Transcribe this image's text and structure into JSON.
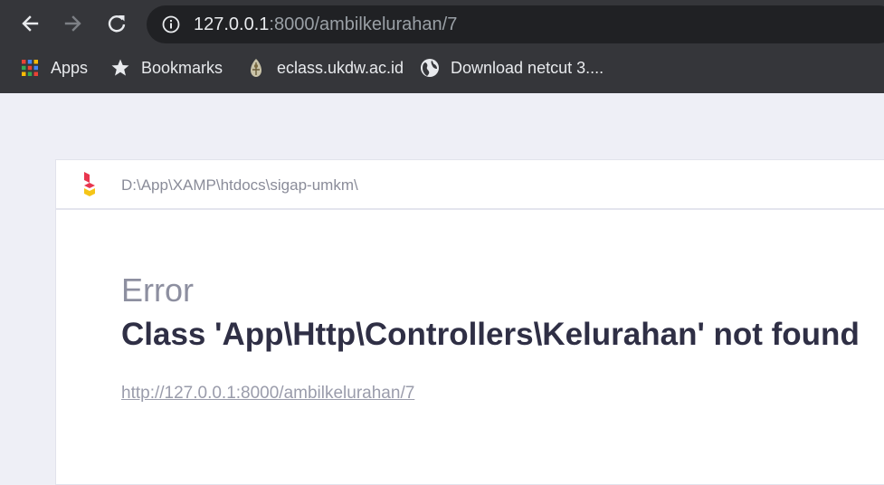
{
  "browser": {
    "url_host": "127.0.0.1",
    "url_rest": ":8000/ambilkelurahan/7",
    "bookmarks": [
      {
        "label": "Apps",
        "icon": "apps-grid-icon"
      },
      {
        "label": "Bookmarks",
        "icon": "star-icon"
      },
      {
        "label": "eclass.ukdw.ac.id",
        "icon": "eclass-favicon"
      },
      {
        "label": "Download netcut 3....",
        "icon": "globe-icon"
      }
    ]
  },
  "page": {
    "path": "D:\\App\\XAMP\\htdocs\\sigap-umkm\\",
    "error_label": "Error",
    "error_message": "Class 'App\\Http\\Controllers\\Kelurahan' not found",
    "error_url": "http://127.0.0.1:8000/ambilkelurahan/7"
  },
  "colors": {
    "chrome_bg": "#35363a",
    "omnibox_bg": "#202124",
    "page_bg": "#eeeff6",
    "accent_red": "#e8364e",
    "accent_yellow": "#f5c518"
  }
}
